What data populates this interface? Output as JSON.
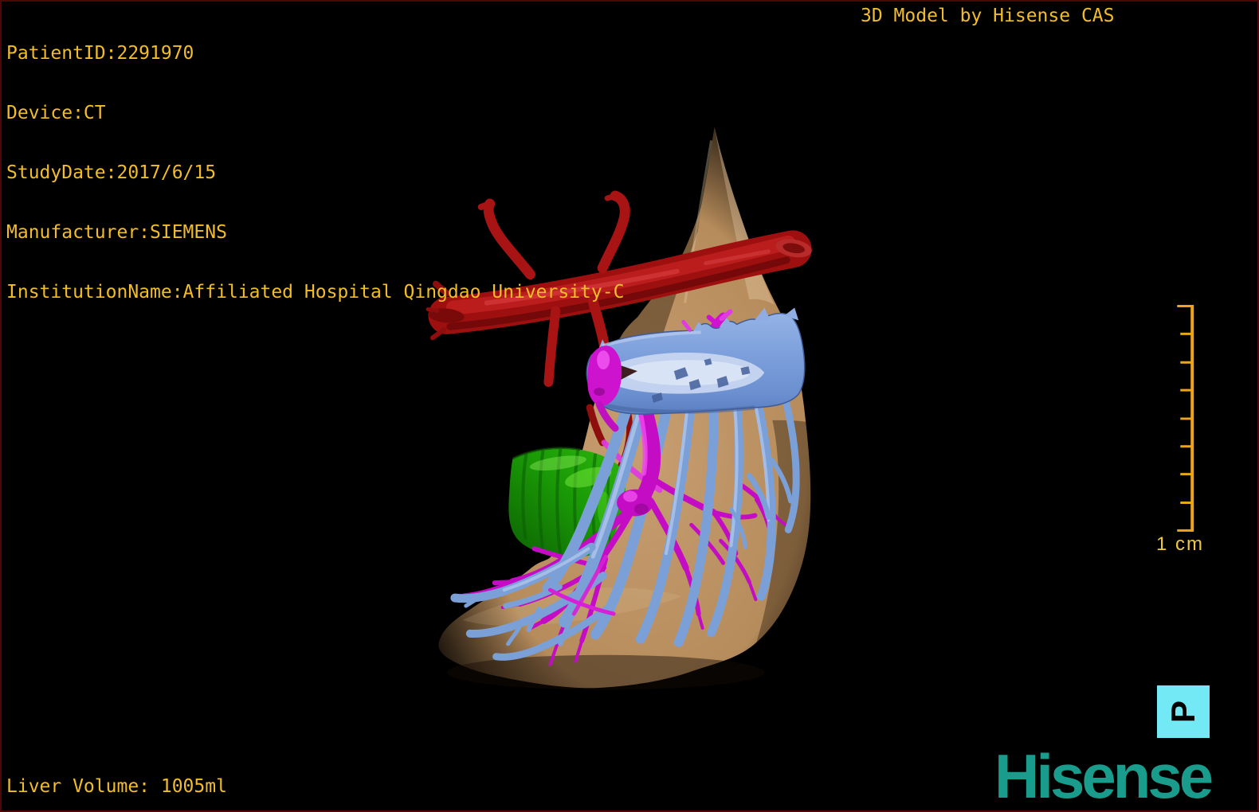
{
  "window": {
    "background": "#000000",
    "border_color": "#4d0707"
  },
  "overlay": {
    "patient_info": {
      "patient_id": "PatientID:2291970",
      "device": "Device:CT",
      "study_date": "StudyDate:2017/6/15",
      "manufacturer": "Manufacturer:SIEMENS",
      "institution": "InstitutionName:Affiliated Hospital Qingdao University-C"
    },
    "title": "3D Model by Hisense CAS",
    "liver_volume": "Liver Volume: 1005ml",
    "scale_label": "1 cm",
    "orientation_marker": "P",
    "logo_text": "Hisense",
    "text_color": "#f2bd28"
  },
  "model": {
    "structures": [
      {
        "name": "liver",
        "color": "#b88f62"
      },
      {
        "name": "hepatic-artery",
        "color": "#9e1010"
      },
      {
        "name": "portal-vein-branches",
        "color": "#c40cc4"
      },
      {
        "name": "hepatic-veins-ivc",
        "color": "#7b9fd8"
      },
      {
        "name": "gallbladder",
        "color": "#1a9a06"
      }
    ]
  },
  "branding": {
    "logo_color": "#1a9c8d",
    "marker_color": "#74e9f6",
    "ruler_color": "#efa51b"
  }
}
